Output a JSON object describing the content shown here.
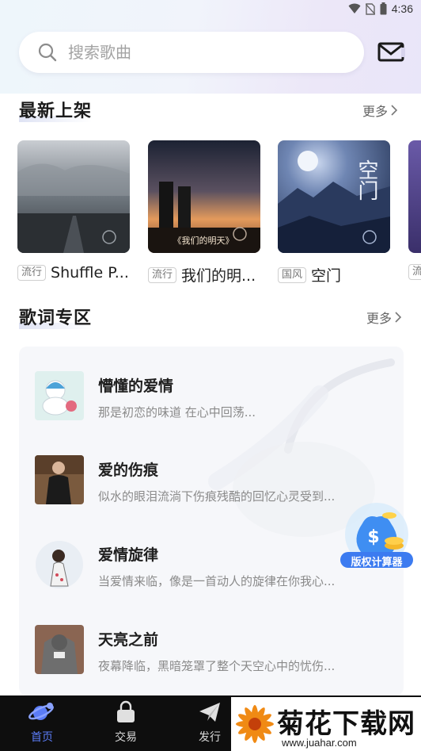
{
  "status_bar": {
    "time": "4:36"
  },
  "search": {
    "placeholder": "搜索歌曲"
  },
  "new_releases": {
    "title": "最新上架",
    "more": "更多",
    "albums": [
      {
        "tag": "流行",
        "name": "Shuffle P..."
      },
      {
        "tag": "流行",
        "name": "我们的明...",
        "cover_text": "《我们的明天》"
      },
      {
        "tag": "国风",
        "name": "空门",
        "cover_text": "空门"
      },
      {
        "tag": "流"
      }
    ]
  },
  "lyrics": {
    "title": "歌词专区",
    "more": "更多",
    "items": [
      {
        "title": "懵懂的爱情",
        "desc": "那是初恋的味道 在心中回荡..."
      },
      {
        "title": "爱的伤痕",
        "desc": "似水的眼泪流淌下伤痕残酷的回忆心灵受到..."
      },
      {
        "title": "爱情旋律",
        "desc": "当爱情来临，像是一首动人的旋律在你我心..."
      },
      {
        "title": "天亮之前",
        "desc": "夜幕降临，黑暗笼罩了整个天空心中的忧伤..."
      }
    ]
  },
  "float_badge": {
    "label": "版权计算器"
  },
  "bottom_nav": {
    "items": [
      {
        "label": "首页",
        "active": true
      },
      {
        "label": "交易"
      },
      {
        "label": "发行"
      }
    ]
  },
  "watermark": {
    "text": "菊花下载网",
    "url": "www.juahar.com"
  }
}
